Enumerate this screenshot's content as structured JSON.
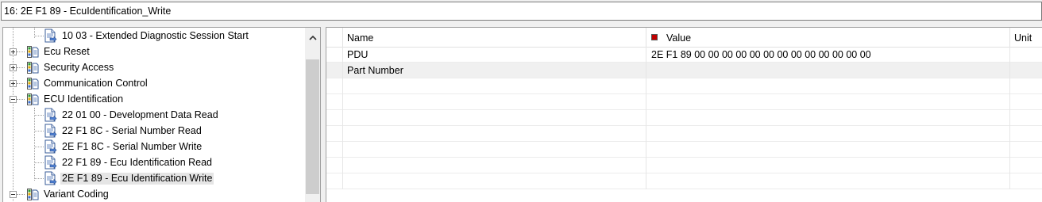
{
  "header": {
    "service_title": "16: 2E F1 89 - EcuIdentification_Write"
  },
  "tree": {
    "items": [
      {
        "label": "10 03 - Extended Diagnostic Session Start",
        "level": 2,
        "type": "service"
      },
      {
        "label": "Ecu Reset",
        "level": 1,
        "type": "group",
        "state": "collapsed"
      },
      {
        "label": "Security Access",
        "level": 1,
        "type": "group",
        "state": "collapsed"
      },
      {
        "label": "Communication Control",
        "level": 1,
        "type": "group",
        "state": "collapsed"
      },
      {
        "label": "ECU Identification",
        "level": 1,
        "type": "group",
        "state": "expanded"
      },
      {
        "label": "22 01 00 - Development Data Read",
        "level": 2,
        "type": "service"
      },
      {
        "label": "22 F1 8C - Serial Number Read",
        "level": 2,
        "type": "service"
      },
      {
        "label": "2E F1 8C - Serial Number Write",
        "level": 2,
        "type": "service"
      },
      {
        "label": "22 F1 89 - Ecu Identification Read",
        "level": 2,
        "type": "service"
      },
      {
        "label": "2E F1 89 - Ecu Identification Write",
        "level": 2,
        "type": "service",
        "selected": true
      },
      {
        "label": "Variant Coding",
        "level": 1,
        "type": "group",
        "state": "expanded"
      }
    ]
  },
  "grid": {
    "columns": {
      "name": "Name",
      "value": "Value",
      "unit": "Unit"
    },
    "rows": [
      {
        "name": "PDU",
        "value": "2E F1 89 00 00 00 00 00 00 00 00 00 00 00 00 00",
        "unit": ""
      },
      {
        "name": "Part Number",
        "value": "",
        "unit": ""
      },
      {
        "name": "",
        "value": "",
        "unit": ""
      },
      {
        "name": "",
        "value": "",
        "unit": ""
      },
      {
        "name": "",
        "value": "",
        "unit": ""
      },
      {
        "name": "",
        "value": "",
        "unit": ""
      },
      {
        "name": "",
        "value": "",
        "unit": ""
      },
      {
        "name": "",
        "value": "",
        "unit": ""
      },
      {
        "name": "",
        "value": "",
        "unit": ""
      }
    ]
  },
  "colors": {
    "value_marker": "#c00000",
    "selection": "#e5e5e5",
    "alt_row": "#f0f0f0"
  }
}
